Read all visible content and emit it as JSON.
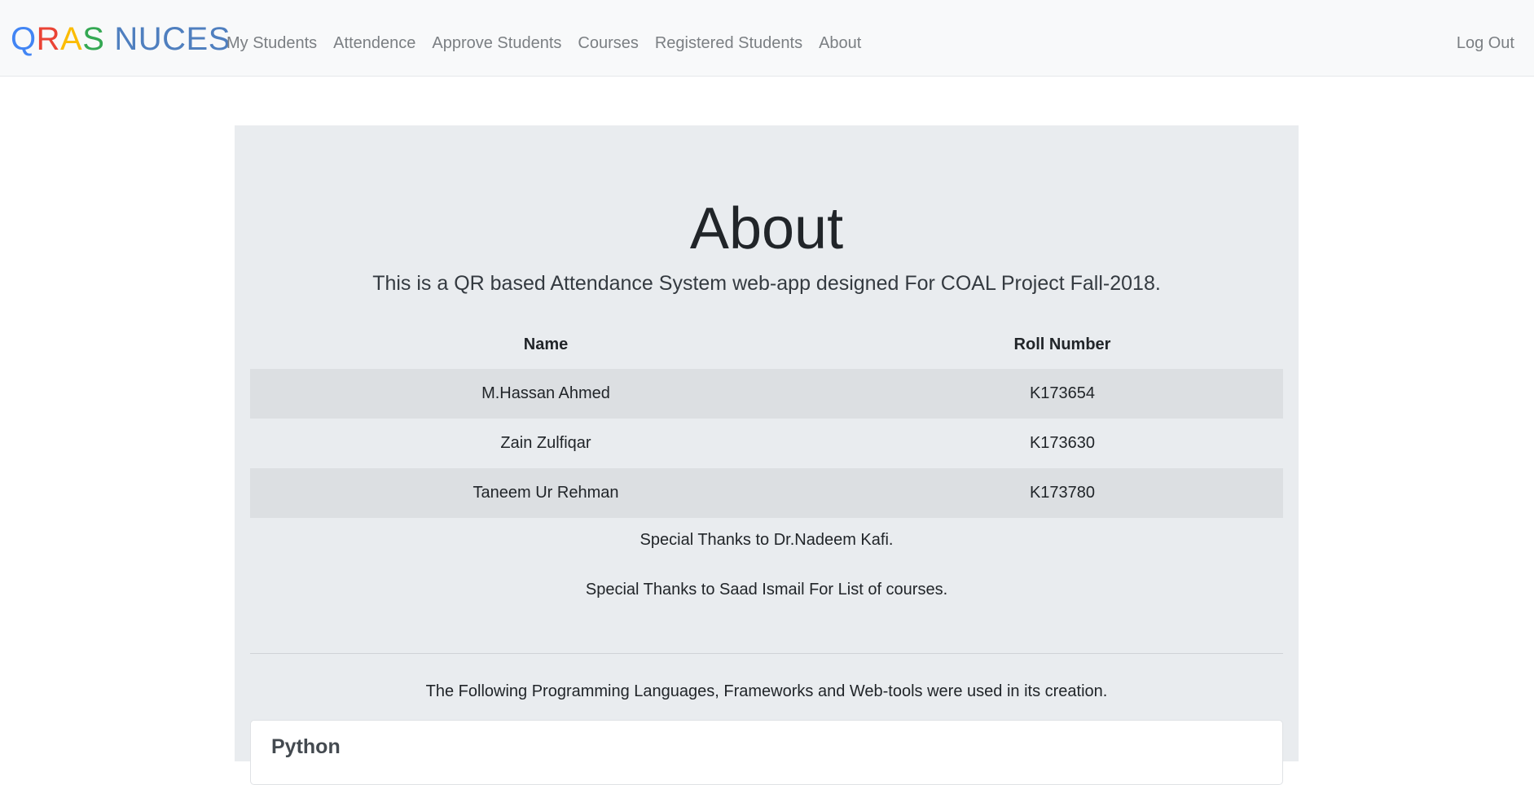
{
  "navbar": {
    "brand": {
      "letters": [
        {
          "char": "Q",
          "color": "#4285f4"
        },
        {
          "char": "R",
          "color": "#ea4335"
        },
        {
          "char": "A",
          "color": "#fbbc05"
        },
        {
          "char": "S",
          "color": "#34a853"
        }
      ],
      "rest": "NUCES",
      "rest_color": "#4f7fbf"
    },
    "links": [
      {
        "label": "My Students"
      },
      {
        "label": "Attendence"
      },
      {
        "label": "Approve Students"
      },
      {
        "label": "Courses"
      },
      {
        "label": "Registered Students"
      },
      {
        "label": "About"
      }
    ],
    "logout": "Log Out"
  },
  "about": {
    "title": "About",
    "lead": "This is a QR based Attendance System web-app designed For COAL Project Fall-2018.",
    "table": {
      "headers": [
        "Name",
        "Roll Number"
      ],
      "rows": [
        {
          "name": "M.Hassan Ahmed",
          "roll": "K173654"
        },
        {
          "name": "Zain Zulfiqar",
          "roll": "K173630"
        },
        {
          "name": "Taneem Ur Rehman",
          "roll": "K173780"
        }
      ]
    },
    "thanks": [
      "Special Thanks to Dr.Nadeem Kafi.",
      "Special Thanks to Saad Ismail For List of courses."
    ],
    "tools_text": "The Following Programming Languages, Frameworks and Web-tools were used in its creation.",
    "cards": [
      {
        "title": "Python"
      }
    ]
  }
}
